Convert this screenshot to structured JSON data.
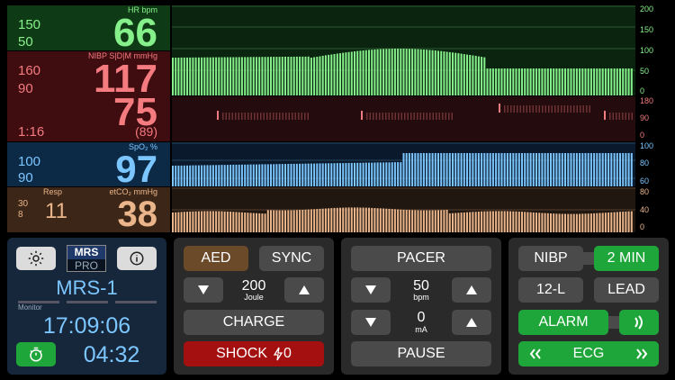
{
  "colors": {
    "hr": "#86f08a",
    "nibp": "#f47b7f",
    "spo2": "#7cc6ff",
    "resp": "#eab58a",
    "accent_green": "#1fa63a",
    "shock_red": "#a40f0f",
    "monitor_bg": "#17273b"
  },
  "hr": {
    "label": "HR bpm",
    "value": "66",
    "limit_high": "150",
    "limit_low": "50"
  },
  "nibp": {
    "label": "NIBP S|D|M mmHg",
    "systolic": "117",
    "diastolic": "75",
    "mean": "(89)",
    "limit_high": "160",
    "limit_low": "90",
    "interval": "1:16"
  },
  "spo2": {
    "label": "SpO₂ %",
    "value": "97",
    "limit_high": "100",
    "limit_low": "90"
  },
  "resp": {
    "label_resp": "Resp",
    "label_etco2": "etCO₂ mmHg",
    "value_resp": "11",
    "value_etco2": "38",
    "limit_high": "30",
    "limit_low": "8"
  },
  "scales": {
    "hr": [
      "200",
      "150",
      "100",
      "50",
      "0"
    ],
    "nibp": [
      "180",
      "90",
      "0"
    ],
    "spo2": [
      "100",
      "80",
      "60"
    ],
    "resp": [
      "80",
      "40",
      "0"
    ]
  },
  "monitor": {
    "settings_icon": "gear-icon",
    "logo_top": "MRS",
    "logo_bottom": "PRO",
    "info_icon": "info-icon",
    "device_name": "MRS-1",
    "mode_label": "Monitor",
    "clock": "17:09:06",
    "timer_icon": "stopwatch-icon",
    "elapsed": "04:32"
  },
  "defib": {
    "aed": "AED",
    "sync": "SYNC",
    "down_icon": "triangle-down-icon",
    "up_icon": "triangle-up-icon",
    "energy": "200",
    "energy_unit": "Joule",
    "charge": "CHARGE",
    "shock": "SHOCK",
    "shock_count": "0",
    "shock_icon": "lightning-icon"
  },
  "pacer": {
    "title": "PACER",
    "rate": "50",
    "rate_unit": "bpm",
    "current": "0",
    "current_unit": "mA",
    "pause": "PAUSE"
  },
  "controls": {
    "nibp": "NIBP",
    "interval": "2 MIN",
    "twelve_lead": "12-L",
    "lead": "LEAD",
    "alarm": "ALARM",
    "alarm_icon": "sound-wave-icon",
    "ecg": "ECG",
    "prev_icon": "chevron-left-icon",
    "next_icon": "chevron-right-icon"
  }
}
